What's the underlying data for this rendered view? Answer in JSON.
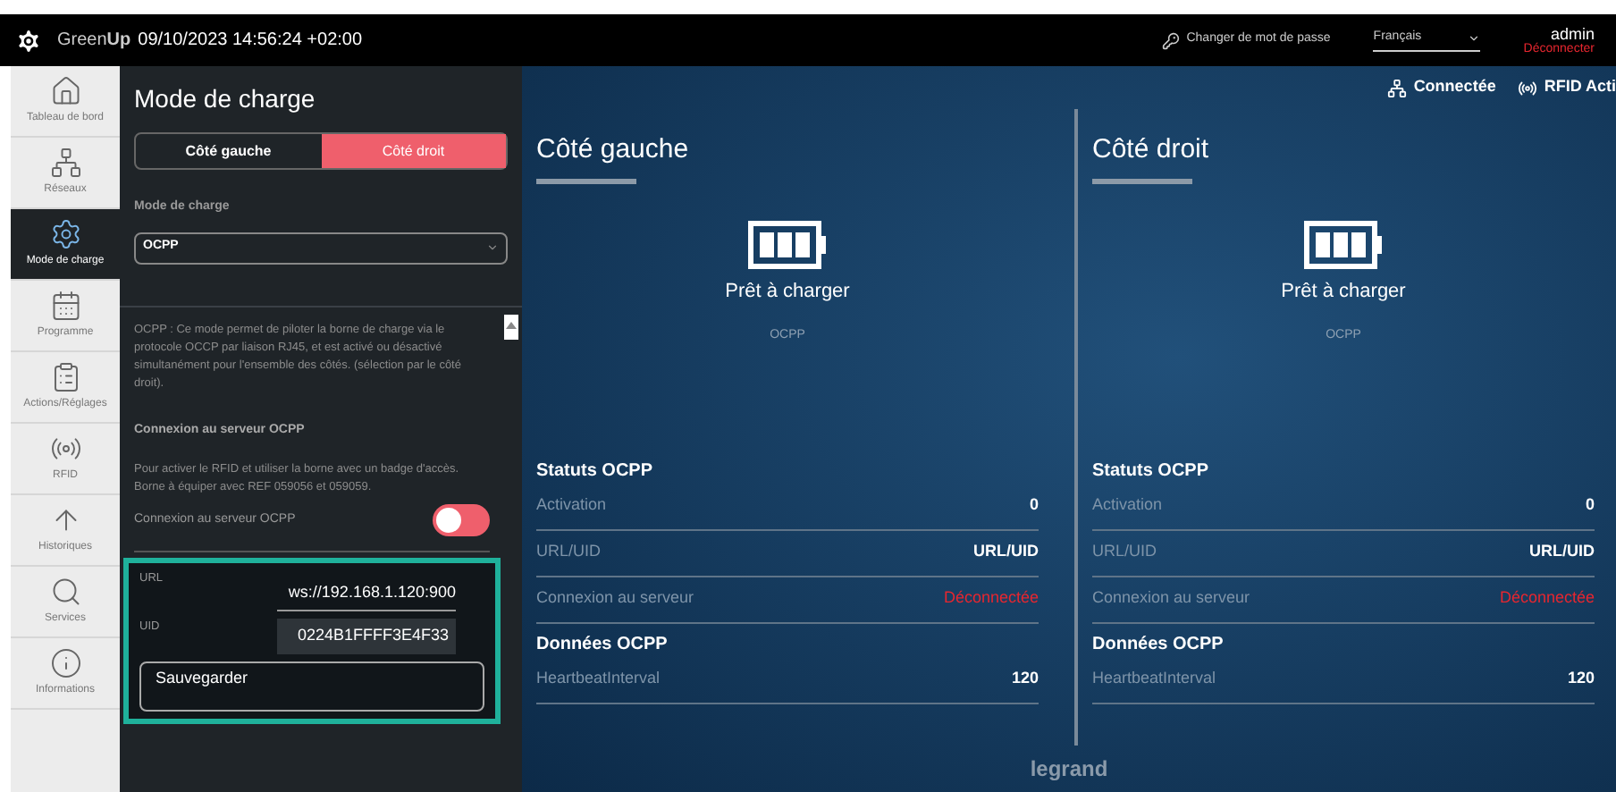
{
  "header": {
    "brand": "Green**Up**",
    "datetime": "09/10/2023 14:56:24 +02:00",
    "password_link": "Changer de mot de passe",
    "language": "Français",
    "user": "admin",
    "logout": "Déconnecter"
  },
  "sidebar": {
    "items": [
      {
        "label": "Tableau de bord",
        "selected": false
      },
      {
        "label": "Réseaux",
        "selected": false
      },
      {
        "label": "Mode de charge",
        "selected": true
      },
      {
        "label": "Programme",
        "selected": false
      },
      {
        "label": "Actions/Réglages",
        "selected": false
      },
      {
        "label": "RFID",
        "selected": false
      },
      {
        "label": "Historiques",
        "selected": false
      },
      {
        "label": "Services",
        "selected": false
      },
      {
        "label": "Informations",
        "selected": false
      }
    ]
  },
  "panel": {
    "title": "Mode de charge",
    "tabs": [
      {
        "label": "Côté gauche",
        "selected": false
      },
      {
        "label": "Côté droit",
        "selected": true
      }
    ],
    "mode_label": "Mode de charge",
    "mode_value": "OCPP",
    "description": "OCPP : Ce mode permet de piloter la borne de charge via le protocole OCCP par liaison RJ45, et est activé ou désactivé simultanément pour l'ensemble des côtés. (sélection par le côté droit).",
    "section_title": "Connexion au serveur OCPP",
    "note": "Pour activer le RFID et utiliser la borne avec un badge d'accès. Borne à équiper avec REF 059056 et 059059.",
    "toggle": {
      "label": "Connexion au serveur OCPP",
      "on": false
    },
    "url": {
      "label": "URL",
      "value": "ws://192.168.1.120:900"
    },
    "uid": {
      "label": "UID",
      "value": "0224B1FFFF3E4F33"
    },
    "save_button": "Sauvegarder"
  },
  "status": {
    "network": "Connectée",
    "rfid": "RFID Acti"
  },
  "sides": [
    {
      "title": "Côté gauche",
      "state": "Prêt à charger",
      "mode": "OCPP",
      "sections": [
        {
          "title": "Statuts OCPP",
          "rows": [
            {
              "label": "Activation",
              "value": "0",
              "alert": false
            },
            {
              "label": "URL/UID",
              "value": "URL/UID",
              "alert": false
            },
            {
              "label": "Connexion au serveur",
              "value": "Déconnectée",
              "alert": true
            }
          ]
        },
        {
          "title": "Données OCPP",
          "rows": [
            {
              "label": "HeartbeatInterval",
              "value": "120",
              "alert": false
            }
          ]
        }
      ]
    },
    {
      "title": "Côté droit",
      "state": "Prêt à charger",
      "mode": "OCPP",
      "sections": [
        {
          "title": "Statuts OCPP",
          "rows": [
            {
              "label": "Activation",
              "value": "0",
              "alert": false
            },
            {
              "label": "URL/UID",
              "value": "URL/UID",
              "alert": false
            },
            {
              "label": "Connexion au serveur",
              "value": "Déconnectée",
              "alert": true
            }
          ]
        },
        {
          "title": "Données OCPP",
          "rows": [
            {
              "label": "HeartbeatInterval",
              "value": "120",
              "alert": false
            }
          ]
        }
      ]
    }
  ],
  "footer": {
    "logo": "legrand"
  }
}
